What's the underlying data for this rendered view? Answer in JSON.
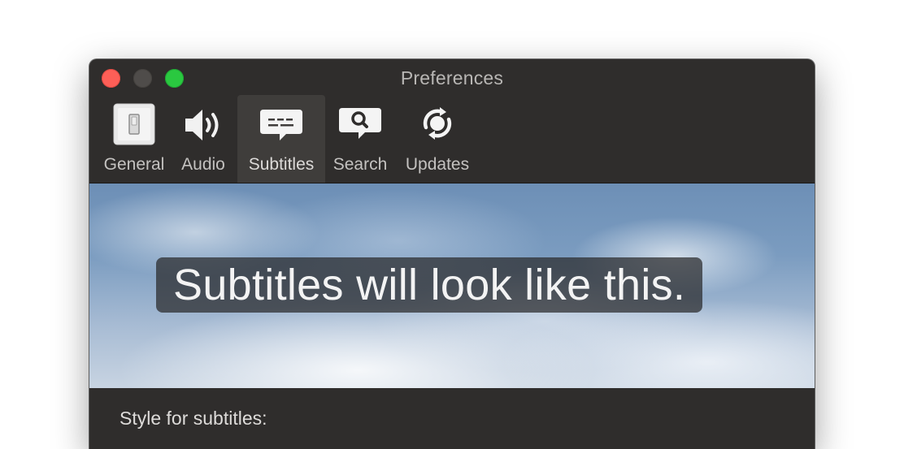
{
  "window": {
    "title": "Preferences"
  },
  "toolbar": {
    "items": [
      {
        "label": "General",
        "icon": "general-switch-icon",
        "selected": false
      },
      {
        "label": "Audio",
        "icon": "speaker-icon",
        "selected": false
      },
      {
        "label": "Subtitles",
        "icon": "subtitles-bubble-icon",
        "selected": true
      },
      {
        "label": "Search",
        "icon": "search-bubble-icon",
        "selected": false
      },
      {
        "label": "Updates",
        "icon": "sync-icon",
        "selected": false
      }
    ]
  },
  "preview": {
    "sample_text": "Subtitles will look like this."
  },
  "settings": {
    "style_label": "Style for subtitles:"
  },
  "colors": {
    "window_bg": "#2f2d2c",
    "selected_tab_bg": "#3f3d3b",
    "close": "#fd5f57",
    "minimize_inactive": "#4f4c4a",
    "zoom": "#2ac840"
  }
}
